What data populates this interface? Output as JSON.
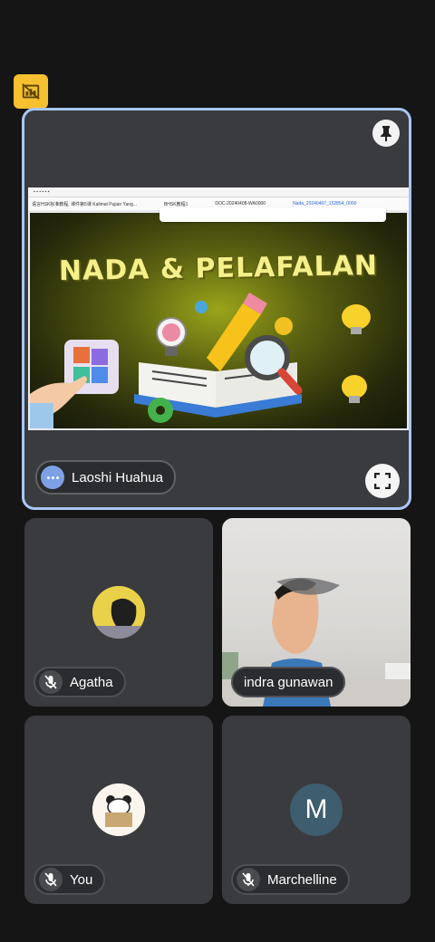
{
  "main": {
    "presenter_name": "Laoshi Huahua",
    "slide": {
      "title": "NADA & PELAFALAN",
      "browser_tab_1": "语言HSK标准教程, 课件第5课 Kalimat Pujian Yang...",
      "browser_tab_2": "BHSK教程1",
      "browser_tab_3": "DOC-20240408-WA0000",
      "browser_tab_4": "Nada_20240407_152854_0000"
    }
  },
  "participants": [
    {
      "name": "Agatha",
      "mic": "off"
    },
    {
      "name": "indra gunawan",
      "mic": "on"
    },
    {
      "name": "You",
      "mic": "off"
    },
    {
      "name": "Marchelline",
      "mic": "off",
      "initial": "M"
    }
  ],
  "you_avatar": {
    "line1": "Huahua",
    "line2": "Learning"
  },
  "colors": {
    "background": "#151515",
    "tile": "#3a3b3e",
    "active_border": "#a9c6f5",
    "badge": "#f6c02e",
    "presenter_dot": "#7ea1e6",
    "initial_avatar": "#3e5d6e"
  },
  "icons": {
    "top_badge": "no-video-presentation-icon",
    "pin": "pin-icon",
    "fullscreen": "fullscreen-icon",
    "more": "more-options-icon",
    "mic_off": "mic-off-icon"
  }
}
